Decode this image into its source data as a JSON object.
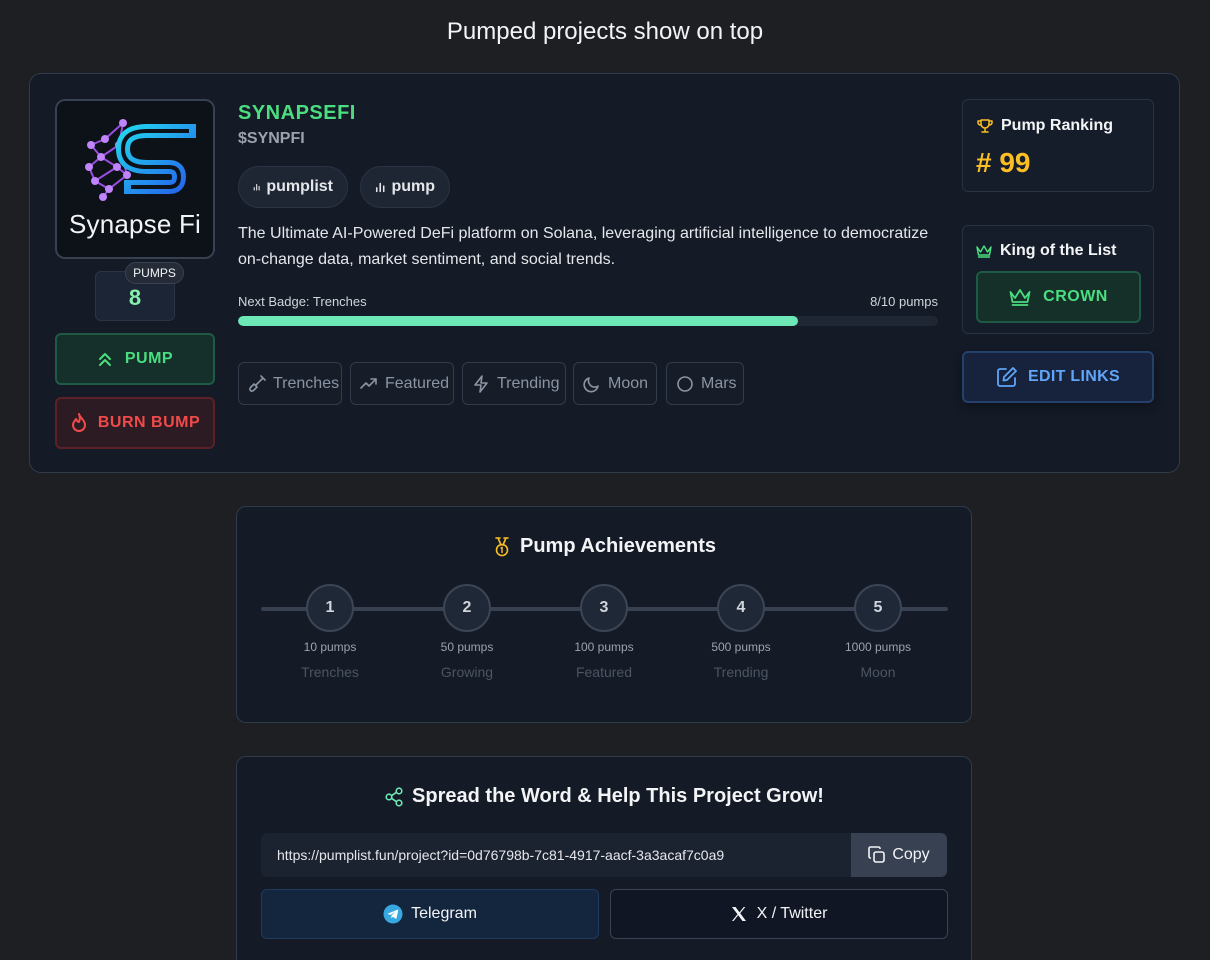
{
  "page": {
    "heading": "Pumped projects show on top"
  },
  "project": {
    "logo_text": "Synapse Fi",
    "name": "SYNAPSEFI",
    "ticker": "$SYNPFI",
    "pumps_label": "PUMPS",
    "pumps_count": "8",
    "pump_button": "PUMP",
    "burn_button": "BURN BUMP",
    "tags": [
      "pumplist",
      "pump"
    ],
    "description": "The Ultimate AI-Powered DeFi platform on Solana, leveraging artificial intelligence to democratize on-change data, market sentiment, and social trends.",
    "next_badge_label": "Next Badge: Trenches",
    "next_badge_progress": "8/10 pumps",
    "progress_fraction": 0.8,
    "badges": [
      "Trenches",
      "Featured",
      "Trending",
      "Moon",
      "Mars"
    ],
    "ranking": {
      "title": "Pump Ranking",
      "value": "# 99"
    },
    "king": {
      "title": "King of the List",
      "button": "CROWN"
    },
    "edit_links_button": "EDIT LINKS"
  },
  "achievements": {
    "title": "Pump Achievements",
    "milestones": [
      {
        "number": "1",
        "requirement": "10 pumps",
        "name": "Trenches"
      },
      {
        "number": "2",
        "requirement": "50 pumps",
        "name": "Growing"
      },
      {
        "number": "3",
        "requirement": "100 pumps",
        "name": "Featured"
      },
      {
        "number": "4",
        "requirement": "500 pumps",
        "name": "Trending"
      },
      {
        "number": "5",
        "requirement": "1000 pumps",
        "name": "Moon"
      }
    ]
  },
  "share": {
    "title": "Spread the Word & Help This Project Grow!",
    "url": "https://pumplist.fun/project?id=0d76798b-7c81-4917-aacf-3a3acaf7c0a9",
    "copy_button": "Copy",
    "telegram_button": "Telegram",
    "twitter_button": "X / Twitter"
  },
  "colors": {
    "accent_green": "#4ade80",
    "accent_red": "#f04a4a",
    "accent_gold": "#fbbf24",
    "accent_blue": "#60a5fa",
    "background": "#1d1f23",
    "card": "#141a26"
  }
}
